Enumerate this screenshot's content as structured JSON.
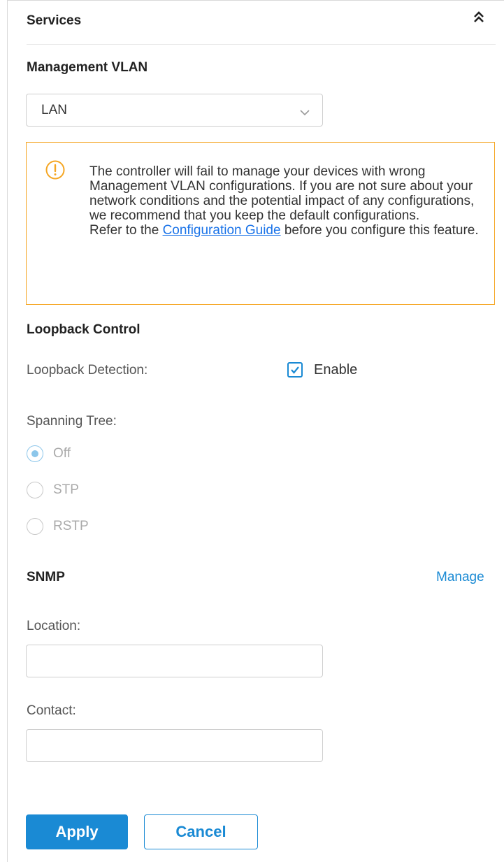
{
  "services": {
    "title": "Services",
    "collapse_icon": "double-chevron-up-icon"
  },
  "management_vlan": {
    "title": "Management VLAN",
    "select_value": "LAN",
    "chevron_icon": "chevron-down-icon"
  },
  "warning": {
    "icon": "exclamation-circle-icon",
    "text_before_link": "The controller will fail to manage your devices with wrong Management VLAN configurations. If you are not sure about your network conditions and the potential impact of any configurations, we recommend that you keep the default configurations.\nRefer to the ",
    "link_text": "Configuration Guide",
    "text_after_link": " before you configure this feature.",
    "border_color": "#f5a623"
  },
  "loopback": {
    "title": "Loopback Control",
    "detection_label": "Loopback Detection:",
    "enable_label": "Enable",
    "enable_checked": true
  },
  "spanning_tree": {
    "label": "Spanning Tree:",
    "options": [
      {
        "label": "Off",
        "checked": true
      },
      {
        "label": "STP",
        "checked": false
      },
      {
        "label": "RSTP",
        "checked": false
      }
    ]
  },
  "snmp": {
    "title": "SNMP",
    "manage_link": "Manage",
    "location_label": "Location:",
    "location_value": "",
    "contact_label": "Contact:",
    "contact_value": ""
  },
  "actions": {
    "apply_label": "Apply",
    "cancel_label": "Cancel"
  },
  "colors": {
    "accent": "#1a8ad4",
    "warning": "#f5a623",
    "disabled_radio": "#8cc6ea"
  }
}
